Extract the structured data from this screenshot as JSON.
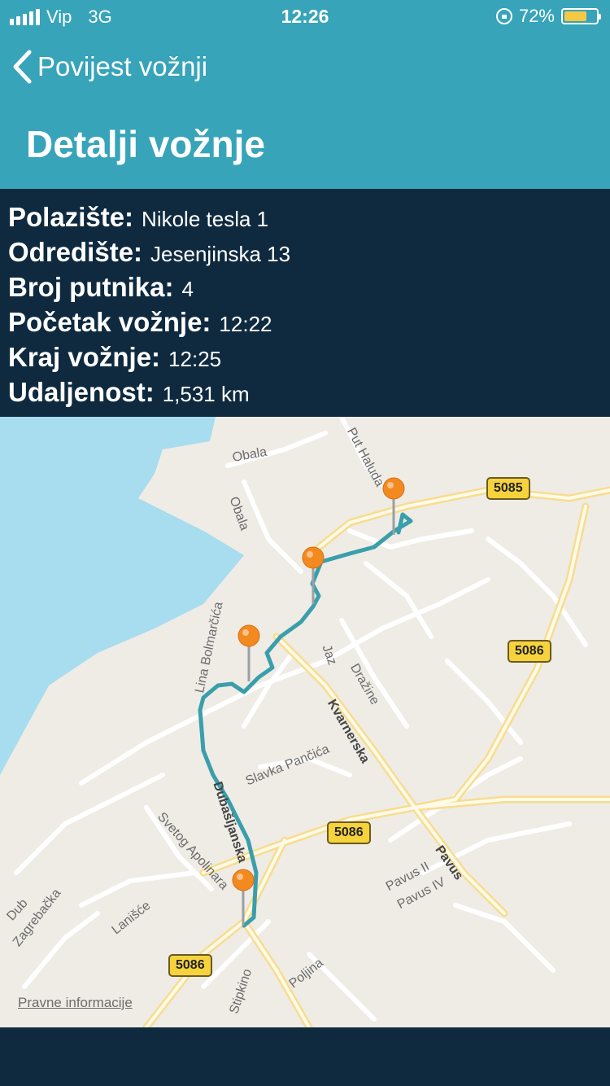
{
  "status_bar": {
    "carrier": "Vip",
    "network": "3G",
    "time": "12:26",
    "battery": "72%",
    "battery_level": 0.72,
    "icons": [
      "signal-icon",
      "orientation-lock-icon",
      "battery-icon"
    ]
  },
  "nav": {
    "back_label": "Povijest vožnji",
    "title": "Detalji vožnje"
  },
  "details": [
    {
      "label": "Polazište:",
      "value": "Nikole tesla 1"
    },
    {
      "label": "Odredište:",
      "value": "Jesenjinska 13"
    },
    {
      "label": "Broj putnika:",
      "value": "4"
    },
    {
      "label": "Početak vožnje:",
      "value": "12:22"
    },
    {
      "label": "Kraj vožnje:",
      "value": "12:25"
    },
    {
      "label": "Udaljenost:",
      "value": "1,531 km"
    }
  ],
  "map": {
    "streets": [
      "Obala",
      "Obala",
      "Put Haluda",
      "Lina Bolmarčića",
      "Jaz",
      "Dražine",
      "Kvarnerska",
      "Slavka Pančića",
      "Dubašljanska",
      "Svetog Apolinara",
      "Pavus",
      "Pavus II",
      "Pavus IV",
      "Lanišće",
      "Dub",
      "Zagrebačka",
      "Stipkino",
      "Poljina"
    ],
    "road_shields": [
      "5085",
      "5086",
      "5086",
      "5086"
    ],
    "legal_link": "Pravne informacije",
    "colors": {
      "water": "#a8dcef",
      "land": "#efece6",
      "route": "#3a9eab",
      "pin": "#f38a1f",
      "major_road": "#fbe6a6"
    }
  },
  "colors": {
    "header": "#37a4b9",
    "panel": "#0f2a3f",
    "battery": "#f7c844"
  }
}
